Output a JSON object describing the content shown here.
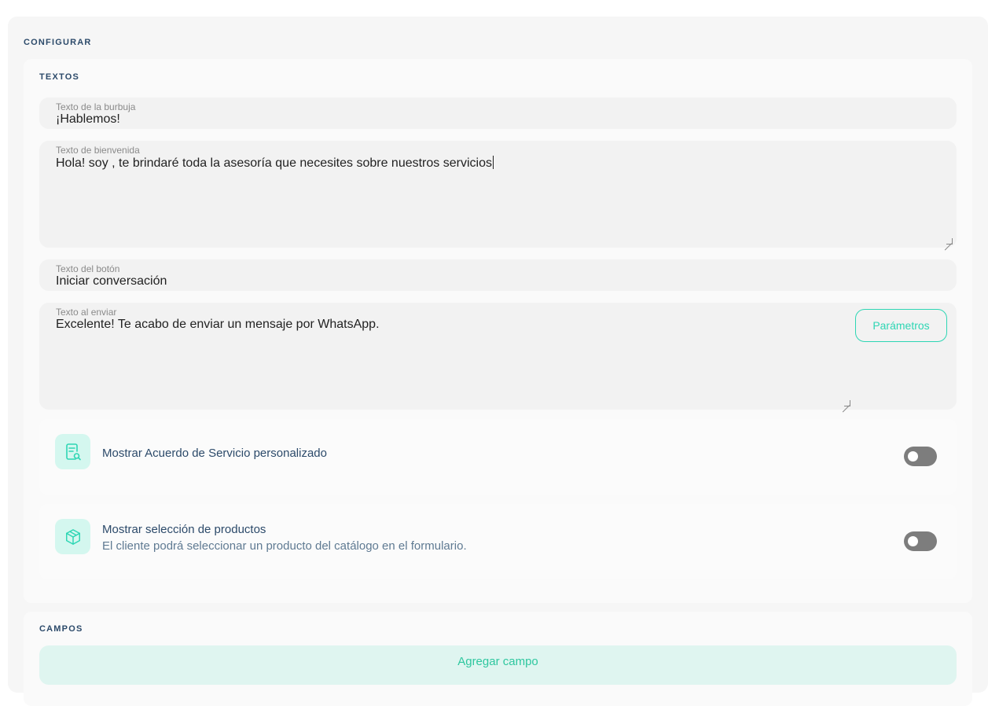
{
  "configurar": {
    "title": "CONFIGURAR"
  },
  "textos": {
    "title": "TEXTOS",
    "bubble": {
      "label": "Texto de la burbuja",
      "value": "¡Hablemos!"
    },
    "welcome": {
      "label": "Texto de bienvenida",
      "value": "Hola! soy , te brindaré toda la asesoría que necesites sobre nuestros servicios"
    },
    "button": {
      "label": "Texto del botón",
      "value": "Iniciar conversación"
    },
    "send": {
      "label": "Texto al enviar",
      "value": "Excelente! Te acabo de enviar un mensaje por WhatsApp.",
      "params_label": "Parámetros"
    },
    "options": [
      {
        "title": "Mostrar Acuerdo de Servicio personalizado",
        "subtitle": "",
        "icon": "document-search-icon",
        "enabled": false
      },
      {
        "title": "Mostrar selección de productos",
        "subtitle": "El cliente podrá seleccionar un producto del catálogo en el formulario.",
        "icon": "box-icon",
        "enabled": false
      }
    ]
  },
  "campos": {
    "title": "CAMPOS",
    "add_label": "Agregar campo"
  },
  "colors": {
    "accent": "#2ed6b4",
    "heading": "#2c4a6a",
    "toggle_off": "#7d7d7d"
  }
}
